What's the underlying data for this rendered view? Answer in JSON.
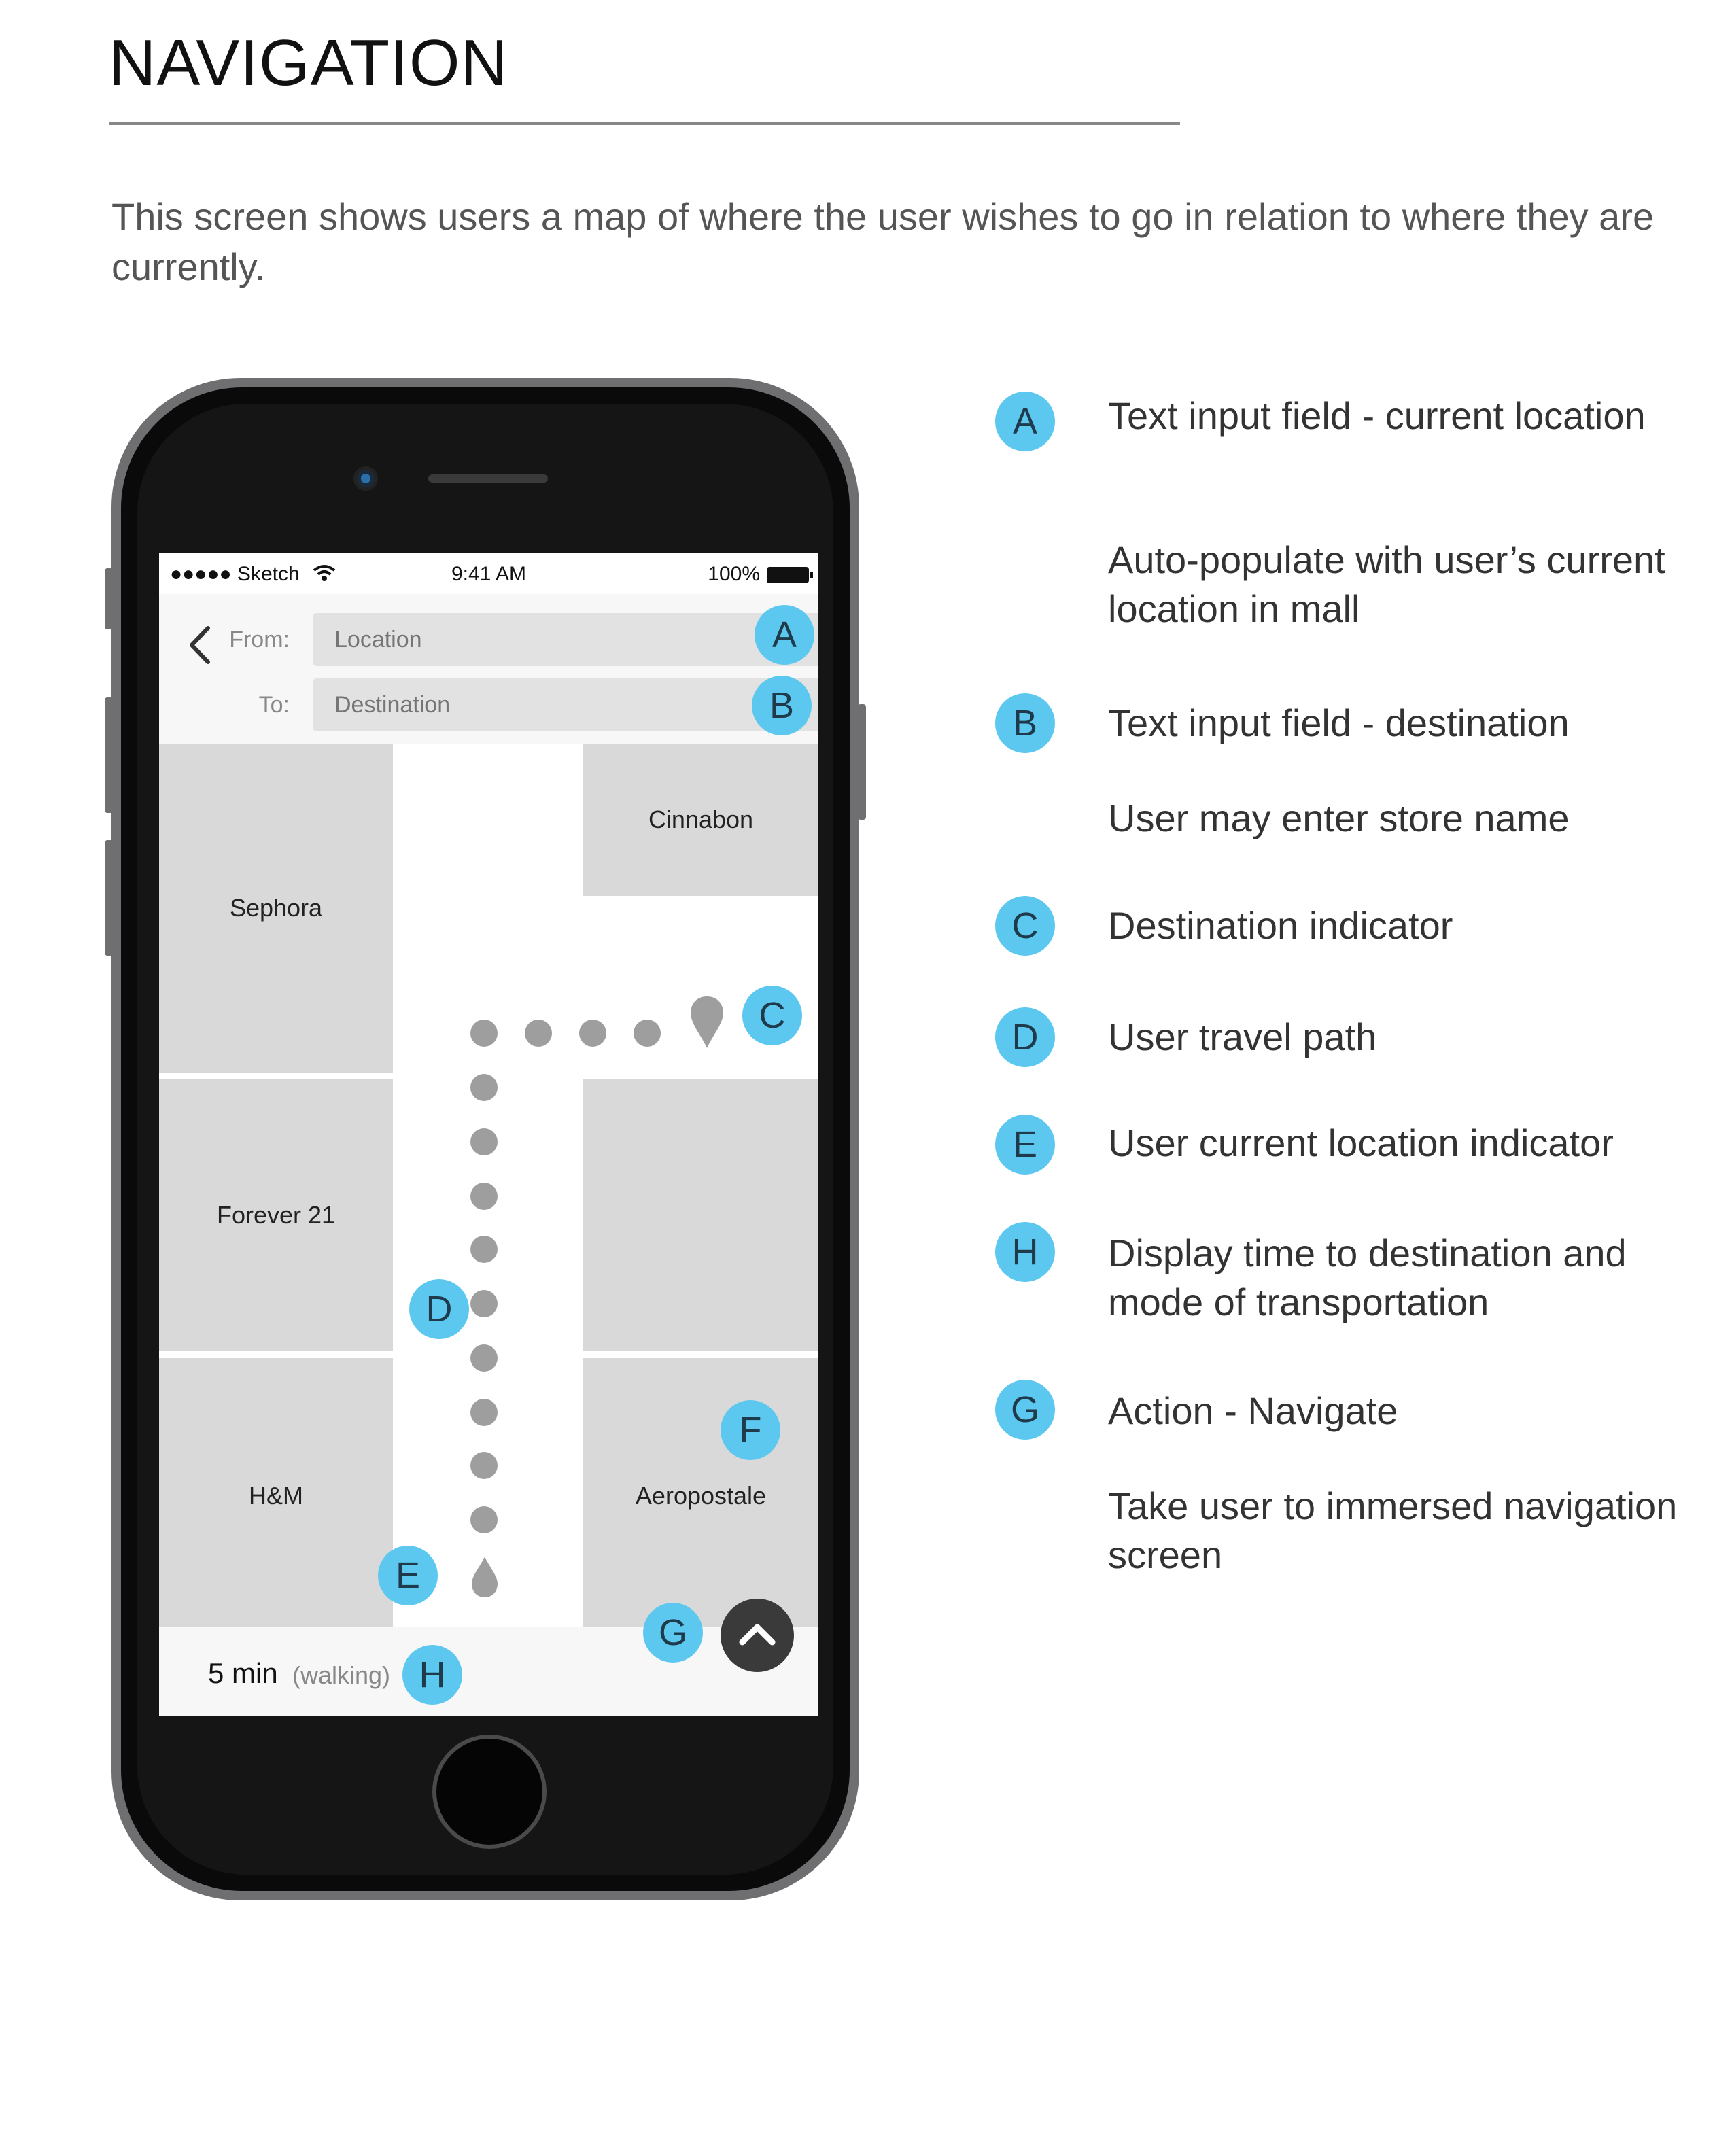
{
  "page": {
    "title": "NAVIGATION",
    "intro": "This screen shows users a map of where the user wishes to go in relation to where they are currently."
  },
  "status_bar": {
    "carrier": "●●●●● Sketch",
    "time": "9:41 AM",
    "battery": "100%"
  },
  "header": {
    "from_label": "From:",
    "from_placeholder": "Location",
    "to_label": "To:",
    "to_placeholder": "Destination"
  },
  "map": {
    "stores": {
      "sephora": "Sephora",
      "cinnabon": "Cinnabon",
      "forever21": "Forever 21",
      "hm": "H&M",
      "aeropostale": "Aeropostale"
    }
  },
  "bottom_bar": {
    "eta_value": "5 min",
    "eta_mode": "(walking)"
  },
  "callouts": {
    "a": "A",
    "b": "B",
    "c": "C",
    "d": "D",
    "e": "E",
    "f": "F",
    "g": "G",
    "h": "H"
  },
  "legend": [
    {
      "letter": "A",
      "title": "Text input field - current location",
      "note": "Auto-populate with user’s current location in mall"
    },
    {
      "letter": "B",
      "title": "Text input field - destination",
      "note": "User may enter store name"
    },
    {
      "letter": "C",
      "title": "Destination indicator"
    },
    {
      "letter": "D",
      "title": "User travel path"
    },
    {
      "letter": "E",
      "title": "User current location indicator"
    },
    {
      "letter": "H",
      "title": "Display time to destination and mode of transportation"
    },
    {
      "letter": "G",
      "title": "Action - Navigate",
      "note": "Take user to immersed navigation screen"
    }
  ],
  "colors": {
    "callout": "#5cc8f0",
    "store_block": "#d9d9d9",
    "path": "#9e9e9e",
    "phone_frame": "#6f6f72"
  }
}
